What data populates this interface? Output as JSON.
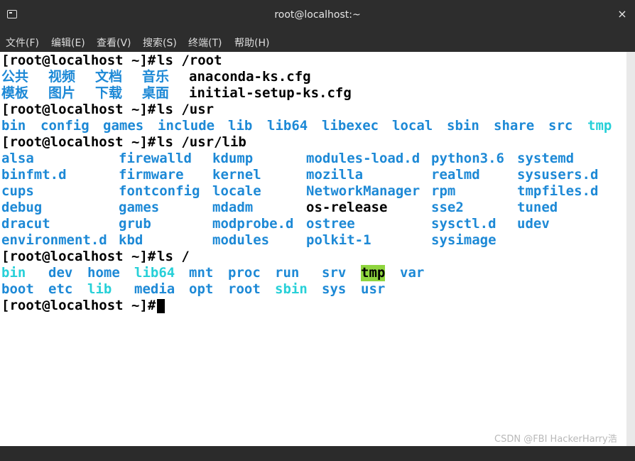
{
  "window": {
    "title": "root@localhost:~",
    "close_glyph": "×",
    "icon": "terminal-icon"
  },
  "menu": [
    "文件(F)",
    "编辑(E)",
    "查看(V)",
    "搜索(S)",
    "终端(T)",
    "帮助(H)"
  ],
  "terminal": {
    "prompt": "[root@localhost ~]#",
    "cmd1": "ls /root",
    "root": [
      "公共",
      "视频",
      "文档",
      "音乐",
      "anaconda-ks.cfg",
      "模板",
      "图片",
      "下载",
      "桌面",
      "initial-setup-ks.cfg"
    ],
    "cmd2": "ls /usr",
    "usr": [
      "bin",
      "config",
      "games",
      "include",
      "lib",
      "lib64",
      "libexec",
      "local",
      "sbin",
      "share",
      "src",
      "tmp"
    ],
    "cmd3": "ls /usr/lib",
    "usrlib": [
      [
        "alsa",
        "firewalld",
        "kdump",
        "modules-load.d",
        "python3.6",
        "systemd"
      ],
      [
        "binfmt.d",
        "firmware",
        "kernel",
        "mozilla",
        "realmd",
        "sysusers.d"
      ],
      [
        "cups",
        "fontconfig",
        "locale",
        "NetworkManager",
        "rpm",
        "tmpfiles.d"
      ],
      [
        "debug",
        "games",
        "mdadm",
        "os-release",
        "sse2",
        "tuned"
      ],
      [
        "dracut",
        "grub",
        "modprobe.d",
        "ostree",
        "sysctl.d",
        "udev"
      ],
      [
        "environment.d",
        "kbd",
        "modules",
        "polkit-1",
        "sysimage",
        ""
      ]
    ],
    "cmd4": "ls /",
    "rootdir": [
      [
        "bin",
        "dev",
        "home",
        "lib64",
        "mnt",
        "proc",
        "run",
        "srv",
        "tmp",
        "var"
      ],
      [
        "boot",
        "etc",
        "lib",
        "media",
        "opt",
        "root",
        "sbin",
        "sys",
        "usr"
      ]
    ],
    "colors": {
      "dir": "#1d89d6",
      "link": "#27d0d8",
      "sticky_bg": "#8fd53e",
      "file": "#000000"
    }
  },
  "watermark": "CSDN @FBI HackerHarry浩"
}
